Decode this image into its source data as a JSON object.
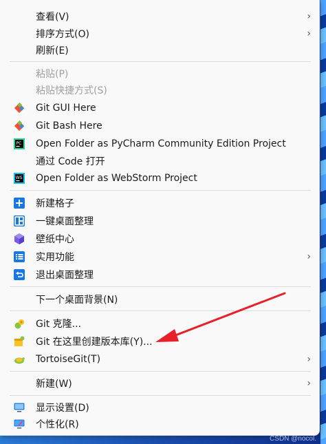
{
  "menu": {
    "view": "查看(V)",
    "sort": "排序方式(O)",
    "refresh": "刷新(E)",
    "paste": "粘贴(P)",
    "paste_shortcut": "粘贴快捷方式(S)",
    "git_gui": "Git GUI Here",
    "git_bash": "Git Bash Here",
    "pycharm": "Open Folder as PyCharm Community Edition Project",
    "code": "通过 Code 打开",
    "webstorm": "Open Folder as WebStorm Project",
    "new_grid": "新建格子",
    "tidy_desktop": "一键桌面整理",
    "wallpaper_center": "壁纸中心",
    "utilities": "实用功能",
    "exit_tidy": "退出桌面整理",
    "next_background": "下一个桌面背景(N)",
    "git_clone": "Git 克隆...",
    "git_create_repo": "Git 在这里创建版本库(Y)...",
    "tortoisegit": "TortoiseGit(T)",
    "new": "新建(W)",
    "display_settings": "显示设置(D)",
    "personalize": "个性化(R)"
  },
  "icons": {
    "pycharm_badge": "PC",
    "webstorm_badge": "WS"
  },
  "watermark": "CSDN @nocol.",
  "colors": {
    "arrow_red": "#e8202a",
    "accent_blue": "#1677e6"
  }
}
